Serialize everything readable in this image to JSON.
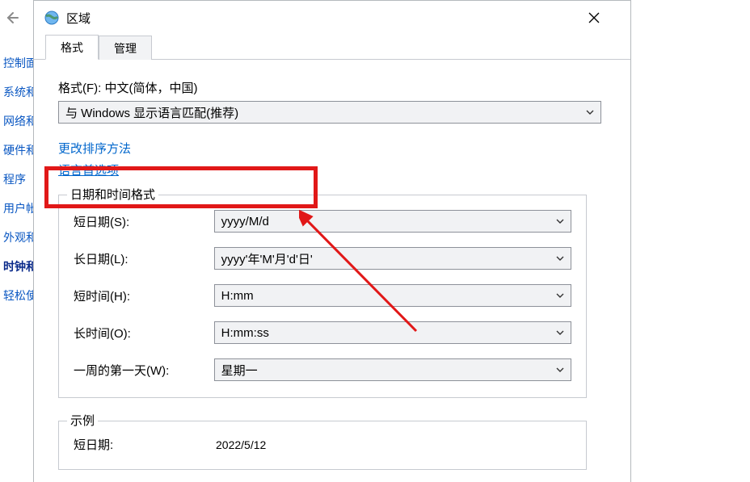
{
  "bg": {
    "arrow": "←",
    "nav": [
      "控制面",
      "系统和",
      "网络和",
      "硬件和",
      "程序",
      "用户帐",
      "外观和",
      "时钟和",
      "轻松使"
    ]
  },
  "dialog": {
    "title": "区域",
    "tabs": {
      "format": "格式",
      "admin": "管理"
    },
    "format_label": "格式(F): 中文(简体，中国)",
    "format_combo": "与 Windows 显示语言匹配(推荐)",
    "link_sort": "更改排序方法",
    "link_lang": "语言首选项",
    "group1": {
      "legend": "日期和时间格式",
      "shortdate_lbl": "短日期(S):",
      "shortdate_val": "yyyy/M/d",
      "longdate_lbl": "长日期(L):",
      "longdate_val": "yyyy'年'M'月'd'日'",
      "shorttime_lbl": "短时间(H):",
      "shorttime_val": "H:mm",
      "longtime_lbl": "长时间(O):",
      "longtime_val": "H:mm:ss",
      "firstday_lbl": "一周的第一天(W):",
      "firstday_val": "星期一"
    },
    "group2": {
      "legend": "示例",
      "shortdate_lbl": "短日期:",
      "shortdate_val": "2022/5/12"
    }
  }
}
